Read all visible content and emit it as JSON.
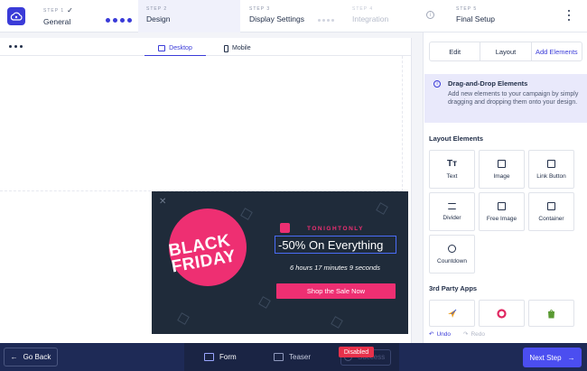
{
  "colors": {
    "brand": "#3a3bd8",
    "popup_bg": "#1f2b3a",
    "accent_pink": "#ee2f72",
    "bottom_bar": "#1e2a56",
    "disabled": "#e7314b",
    "next": "#4b4ef0"
  },
  "steps": [
    {
      "kicker": "STEP 1",
      "name": "General",
      "done": true
    },
    {
      "kicker": "STEP 2",
      "name": "Design"
    },
    {
      "kicker": "STEP 3",
      "name": "Display Settings"
    },
    {
      "kicker": "STEP 4",
      "name": "Integration"
    },
    {
      "kicker": "STEP 5",
      "name": "Final Setup"
    }
  ],
  "canvas": {
    "devices": {
      "desktop": "Desktop",
      "mobile": "Mobile"
    }
  },
  "popup": {
    "badge_line1": "BLACK",
    "badge_line2": "FRIDAY",
    "brand": "TONIGHTONLY",
    "headline": "-50% On Everything",
    "countdown": "6 hours 17 minutes 9 seconds",
    "cta": "Shop the Sale Now"
  },
  "panel": {
    "tabs": [
      "Edit",
      "Layout",
      "Add Elements"
    ],
    "active_tab": "Add Elements",
    "info_title": "Drag-and-Drop Elements",
    "info_desc": "Add new elements to your campaign by simply dragging and dropping them onto your design.",
    "layout_title": "Layout Elements",
    "elements": [
      {
        "label": "Text",
        "icon": "text-icon"
      },
      {
        "label": "Image",
        "icon": "image-icon"
      },
      {
        "label": "Link Button",
        "icon": "link-button-icon"
      },
      {
        "label": "Divider",
        "icon": "divider-icon"
      },
      {
        "label": "Free Image",
        "icon": "free-image-icon"
      },
      {
        "label": "Container",
        "icon": "container-icon"
      },
      {
        "label": "Countdown",
        "icon": "countdown-icon"
      }
    ],
    "apps_title": "3rd Party Apps",
    "apps": [
      {
        "icon": "paper-plane-app-icon",
        "color": "#f0a020"
      },
      {
        "icon": "ring-app-icon",
        "color": "#e02660"
      },
      {
        "icon": "shopify-app-icon",
        "color": "#5a9a32"
      }
    ],
    "undo": "Undo",
    "redo": "Redo"
  },
  "bottom": {
    "go_back": "Go Back",
    "tabs": [
      "Form",
      "Teaser",
      "Success"
    ],
    "disabled_badge": "Disabled",
    "next": "Next Step"
  }
}
